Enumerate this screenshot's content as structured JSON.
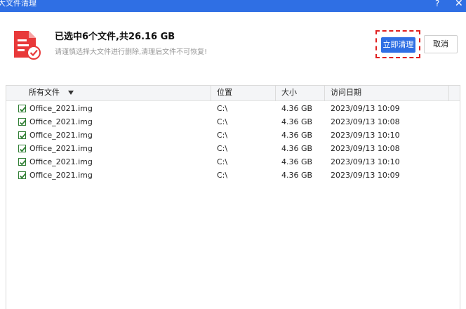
{
  "window": {
    "title": "大文件清理",
    "help_label": "?",
    "close_label": "✕"
  },
  "header": {
    "summary": "已选中6个文件,共26.16 GB",
    "hint": "请谨慎选择大文件进行删除,清理后文件不可恢复!"
  },
  "actions": {
    "confirm_label": "立即清理",
    "cancel_label": "取消"
  },
  "table": {
    "columns": [
      "所有文件",
      "位置",
      "大小",
      "访问日期"
    ],
    "rows": [
      {
        "checked": true,
        "name": "Office_2021.img",
        "location": "C:\\",
        "size": "4.36 GB",
        "date": "2023/09/13 10:09"
      },
      {
        "checked": true,
        "name": "Office_2021.img",
        "location": "C:\\",
        "size": "4.36 GB",
        "date": "2023/09/13 10:08"
      },
      {
        "checked": true,
        "name": "Office_2021.img",
        "location": "C:\\",
        "size": "4.36 GB",
        "date": "2023/09/13 10:10"
      },
      {
        "checked": true,
        "name": "Office_2021.img",
        "location": "C:\\",
        "size": "4.36 GB",
        "date": "2023/09/13 10:08"
      },
      {
        "checked": true,
        "name": "Office_2021.img",
        "location": "C:\\",
        "size": "4.36 GB",
        "date": "2023/09/13 10:10"
      },
      {
        "checked": true,
        "name": "Office_2021.img",
        "location": "C:\\",
        "size": "4.36 GB",
        "date": "2023/09/13 10:09"
      }
    ]
  },
  "colors": {
    "accent": "#2f6fe4",
    "highlight": "#e02020",
    "icon_red": "#e8393a",
    "check_green": "#2e7d32"
  },
  "icons": {
    "file": "large-file-icon",
    "sort": "sort-down-icon",
    "checkbox": "checkbox-checked-icon"
  }
}
